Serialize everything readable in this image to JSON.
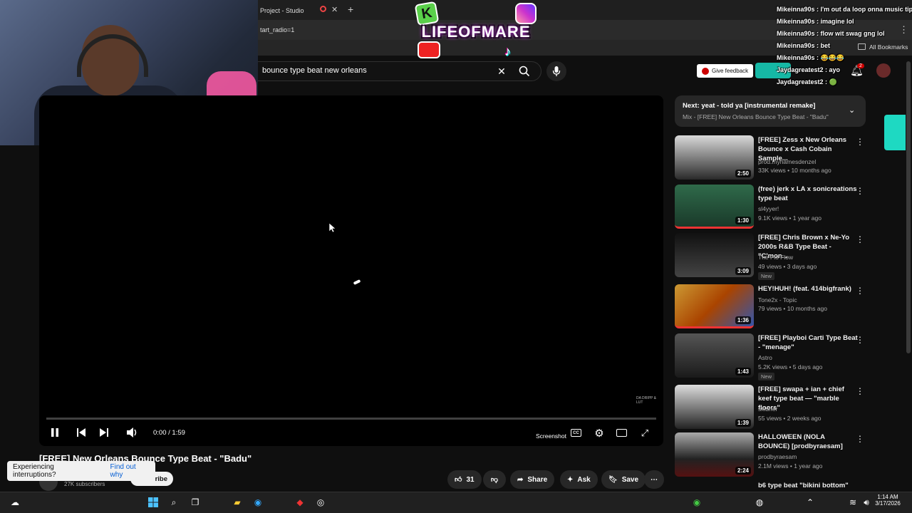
{
  "browser": {
    "tab_title": "Project - Studio",
    "address_fragment": "tart_radio=1",
    "bookmarks_label": "All Bookmarks"
  },
  "youtube": {
    "search_query": "bounce type beat new orleans",
    "feedback_label": "Give feedback",
    "notification_count": "2"
  },
  "player": {
    "time": "0:00 / 1:59",
    "screenshot_label": "Screenshot",
    "watermark": "DA DRIPP & LUT",
    "video_title": "[FREE] New Orleans Bounce Type Beat - \"Badu\"",
    "subscribers": "27K subscribers",
    "subscribe_fragment": "ribe",
    "likes": "31",
    "share_label": "Share",
    "ask_label": "Ask",
    "save_label": "Save"
  },
  "toast": {
    "message": "Experiencing interruptions?",
    "link": "Find out why"
  },
  "upnext": {
    "title": "Next: yeat - told ya [instrumental remake]",
    "subtitle": "Mix - [FREE] New Orleans Bounce Type Beat - \"Badu\""
  },
  "videos": [
    {
      "title": "[FREE] Zess x New Orleans Bounce x Cash Cobain Sample...",
      "channel": "prod.mynamesdenzel",
      "meta": "33K views • 10 months ago",
      "duration": "2:50",
      "badge": ""
    },
    {
      "title": "(free) jerk x LA x sonicreations type beat",
      "channel": "sl4yyer!",
      "meta": "9.1K views • 1 year ago",
      "duration": "1:30",
      "badge": ""
    },
    {
      "title": "[FREE] Chris Brown x Ne-Yo 2000s R&B Type Beat - \"C'mon...",
      "channel": "The Fio Flow",
      "meta": "49 views • 3 days ago",
      "duration": "3:09",
      "badge": "New"
    },
    {
      "title": "HEY!HUH! (feat. 414bigfrank)",
      "channel": "Tone2x - Topic",
      "meta": "79 views • 10 months ago",
      "duration": "1:36",
      "badge": ""
    },
    {
      "title": "[FREE] Playboi Carti Type Beat - \"menage\"",
      "channel": "Astro",
      "meta": "5.2K views • 5 days ago",
      "duration": "1:43",
      "badge": "New"
    },
    {
      "title": "[FREE] swapa + ian + chief keef type beat — \"marble floors\"",
      "channel": "sxldner",
      "meta": "55 views • 2 weeks ago",
      "duration": "1:39",
      "badge": ""
    },
    {
      "title": "HALLOWEEN (NOLA BOUNCE) [prodbyraesam]",
      "channel": "prodbyraesam",
      "meta": "2.1M views • 1 year ago",
      "duration": "2:24",
      "badge": ""
    },
    {
      "title": "b6 type beat \"bikini bottom\"",
      "channel": "",
      "meta": "",
      "duration": "",
      "badge": ""
    }
  ],
  "overlay": {
    "logo_text": "LIFEOFMARE",
    "logo_k": "K",
    "chat": [
      "Mikeinna90s : I'm out da loop onna music tip",
      "Mikeinna90s : imagine lol",
      "Mikeinna90s : flow wit swag gng lol",
      "Mikeinna90s : bet",
      "Mikeinna90s : 😂😂😂",
      "Jaydagreatest2 : ayo",
      "Jaydagreatest2 : 🟢"
    ]
  },
  "taskbar": {
    "time": "1:14 AM",
    "date": "3/17/2026"
  }
}
